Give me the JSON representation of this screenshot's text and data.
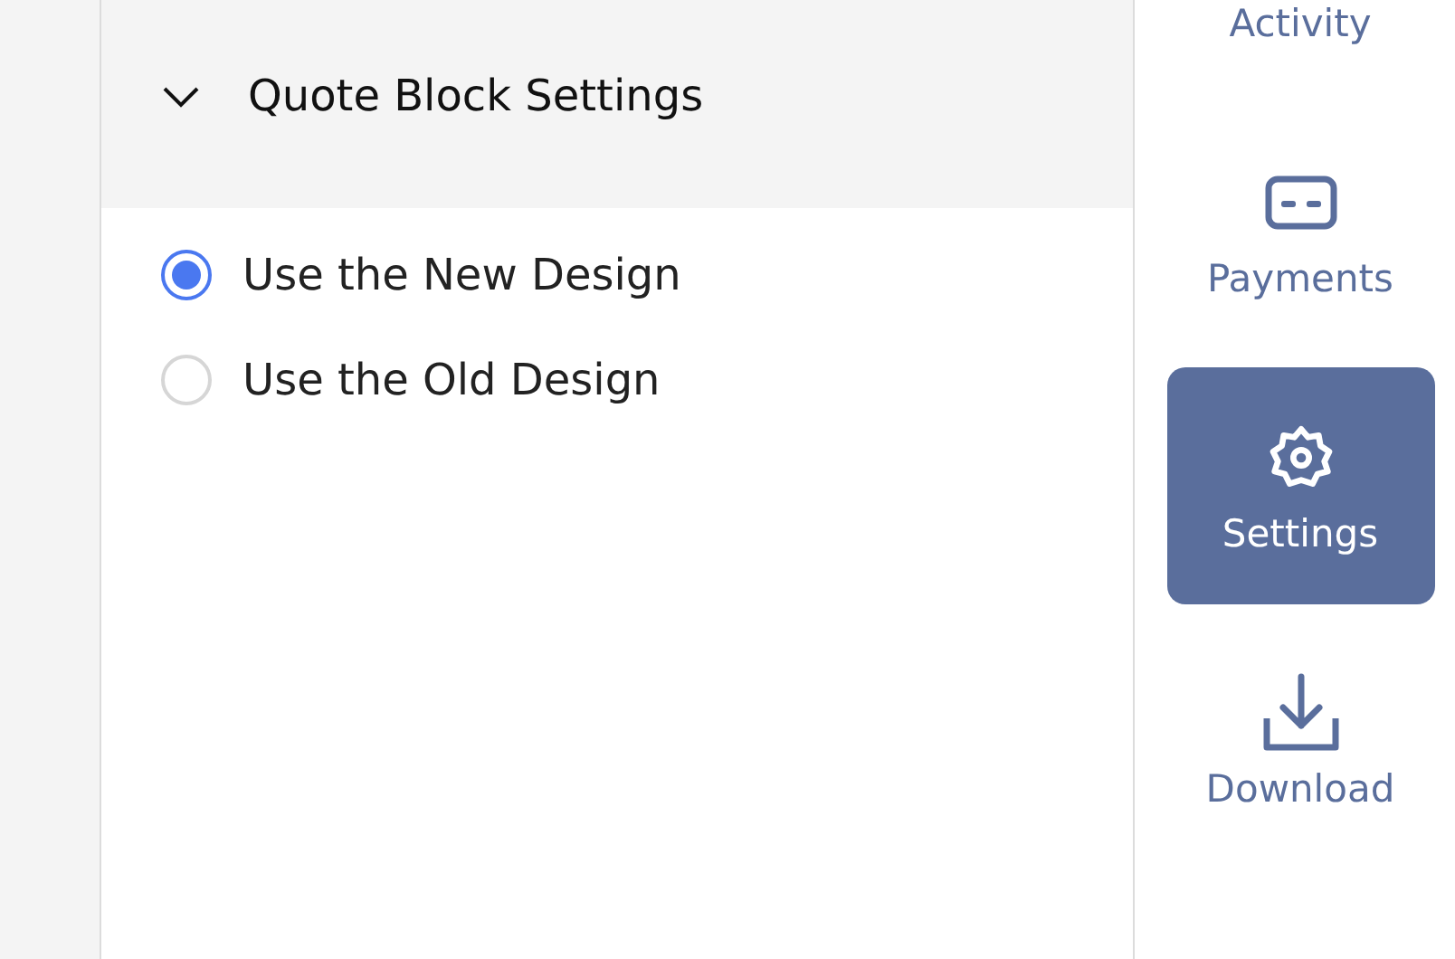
{
  "panel": {
    "section": {
      "title": "Quote Block Settings",
      "expanded": true
    },
    "options": [
      {
        "label": "Use the New Design",
        "selected": true
      },
      {
        "label": "Use the Old Design",
        "selected": false
      }
    ]
  },
  "sidebar": {
    "items": [
      {
        "label": "Activity",
        "kind": "none",
        "selected": false
      },
      {
        "label": "Payments",
        "kind": "card",
        "selected": false
      },
      {
        "label": "Settings",
        "kind": "gear",
        "selected": true
      },
      {
        "label": "Download",
        "kind": "download",
        "selected": false
      }
    ]
  }
}
